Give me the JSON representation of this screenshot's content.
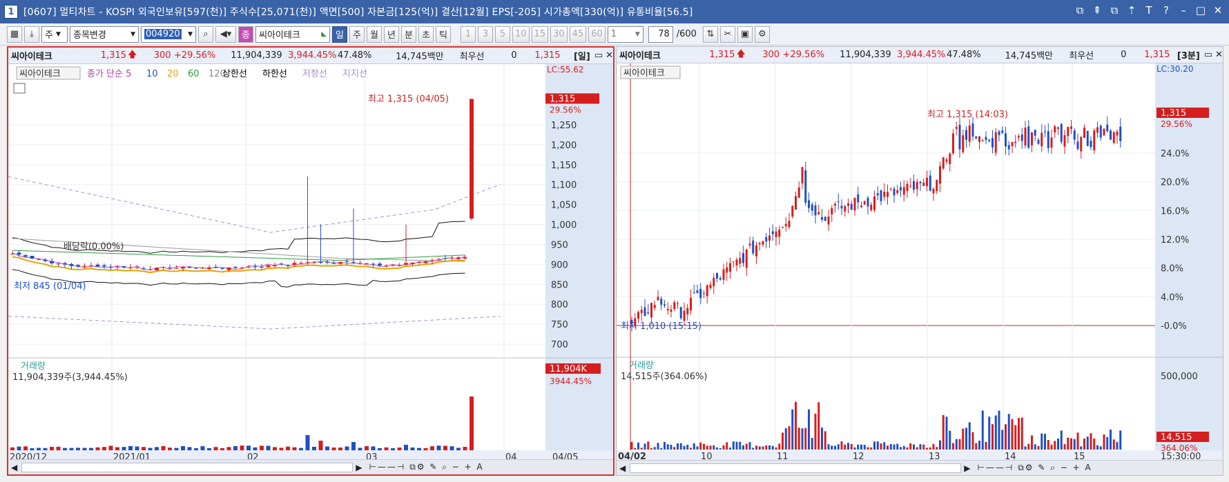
{
  "window": {
    "icon_label": "1",
    "title": "[0607] 멀티차트 - KOSPI 외국인보유[597(천)] 주식수[25,071(천)] 액면[500] 자본금[125(억)] 결산[12월] EPS[-205] 시가총액[330(억)] 유통비율[56.5]",
    "buttons": [
      "⧉",
      "⇞",
      "⧉",
      "⇡",
      "T",
      "?",
      "–",
      "□",
      "✕"
    ]
  },
  "toolbar": {
    "type_select": "주",
    "change_select": "종목변경",
    "code_value": "004920",
    "stock_badge": "종",
    "stock_name": "씨아이테크",
    "periods": [
      "일",
      "주",
      "월",
      "년",
      "분",
      "초",
      "틱"
    ],
    "selected_period": "일",
    "intervals": [
      "1",
      "3",
      "5",
      "10",
      "15",
      "30",
      "45",
      "60"
    ],
    "interval_value": "1",
    "count_value": "78",
    "count_total": "/600"
  },
  "left": {
    "name": "씨아이테크",
    "price": "1,315",
    "change": "300",
    "change_pct": "+29.56%",
    "volume": "11,904,339",
    "volume_pct": "3,944.45%",
    "turnover": "47.48%",
    "amount": "14,745백만",
    "priority": "최우선",
    "priority_qty": "0",
    "price2": "1,315",
    "period_label": "[일]",
    "legend_name": "씨아이테크",
    "legend_ma": "종가 단순 5",
    "ma_periods": [
      "10",
      "20",
      "60",
      "120"
    ],
    "legend_extra": [
      "상한선",
      "하한선",
      "저항선",
      "지지선"
    ],
    "lc": "LC:55.62",
    "last_price_tag": "1,315",
    "last_pct_tag": "29.56%",
    "high_label": "최고 1,315 (04/05)",
    "low_label": "최저 845 (01/04)",
    "dividend_label": "배당락(0.00%)",
    "volume_title": "거래량",
    "volume_text": "11,904,339주(3,944.45%)",
    "volume_tag": "11,904K",
    "volume_pct_tag": "3944.45%",
    "y_ticks": [
      "1,250",
      "1,200",
      "1,150",
      "1,100",
      "1,050",
      "1,000",
      "950",
      "900",
      "850",
      "800",
      "750",
      "700"
    ],
    "x_ticks": [
      "2020/12",
      "2021/01",
      "02",
      "03",
      "04"
    ],
    "x_end": "04/05"
  },
  "right": {
    "name": "씨아이테크",
    "price": "1,315",
    "change": "300",
    "change_pct": "+29.56%",
    "volume": "11,904,339",
    "volume_pct": "3,944.45%",
    "turnover": "47.48%",
    "amount": "14,745백만",
    "priority": "최우선",
    "priority_qty": "0",
    "price2": "1,315",
    "period_label": "[3분]",
    "legend_name": "씨아이테크",
    "lc": "LC:30.20",
    "last_price_tag": "1,315",
    "last_pct_tag": "29.56%",
    "high_label": "최고 1,315 (14:03)",
    "low_label": "최저 1,010 (15:15)",
    "volume_title": "거래량",
    "volume_text": "14,515주(364.06%)",
    "volume_tag": "14,515",
    "volume_pct_tag": "364.06%",
    "vol_tick": "500,000",
    "y_ticks": [
      "24.0%",
      "20.0%",
      "16.0%",
      "12.0%",
      "8.0%",
      "4.0%",
      "-0.0%"
    ],
    "x_ticks": [
      "04/02",
      "10",
      "11",
      "12",
      "13",
      "14",
      "15"
    ],
    "x_end": "15:30:00"
  },
  "colors": {
    "up": "#d51e1e",
    "down": "#1f4fc8",
    "title_bar": "#3a63a7",
    "axis_bg": "#dce6f4"
  }
}
